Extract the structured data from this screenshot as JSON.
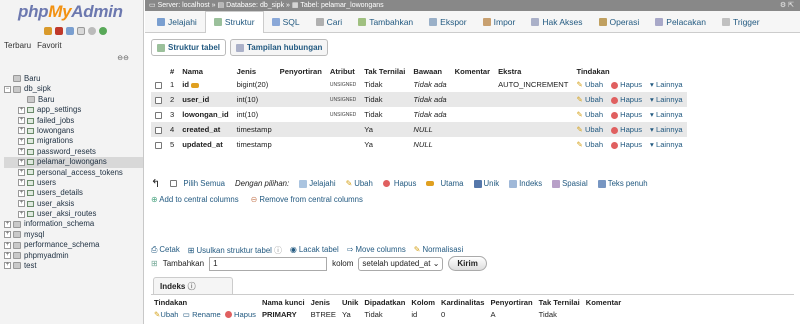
{
  "sidebar": {
    "logo_php": "php",
    "logo_my": "My",
    "logo_admin": "Admin",
    "tab_recent": "Terbaru",
    "tab_favorite": "Favorit",
    "items": [
      {
        "label": "Baru",
        "level": 0
      },
      {
        "label": "db_sipk",
        "level": 0
      },
      {
        "label": "Baru",
        "level": 1
      },
      {
        "label": "app_settings",
        "level": 1
      },
      {
        "label": "failed_jobs",
        "level": 1
      },
      {
        "label": "lowongans",
        "level": 1
      },
      {
        "label": "migrations",
        "level": 1
      },
      {
        "label": "password_resets",
        "level": 1
      },
      {
        "label": "pelamar_lowongans",
        "level": 1
      },
      {
        "label": "personal_access_tokens",
        "level": 1
      },
      {
        "label": "users",
        "level": 1
      },
      {
        "label": "users_details",
        "level": 1
      },
      {
        "label": "user_aksis",
        "level": 1
      },
      {
        "label": "user_aksi_routes",
        "level": 1
      },
      {
        "label": "information_schema",
        "level": 0
      },
      {
        "label": "mysql",
        "level": 0
      },
      {
        "label": "performance_schema",
        "level": 0
      },
      {
        "label": "phpmyadmin",
        "level": 0
      },
      {
        "label": "test",
        "level": 0
      }
    ]
  },
  "breadcrumb": {
    "server": "Server: localhost",
    "database": "Database: db_sipk",
    "table": "Tabel: pelamar_lowongans"
  },
  "tabs": [
    "Jelajahi",
    "Struktur",
    "SQL",
    "Cari",
    "Tambahkan",
    "Ekspor",
    "Impor",
    "Hak Akses",
    "Operasi",
    "Pelacakan",
    "Trigger"
  ],
  "subtabs": {
    "structure": "Struktur tabel",
    "relations": "Tampilan hubungan"
  },
  "structure": {
    "headers": [
      "#",
      "Nama",
      "Jenis",
      "Penyortiran",
      "Atribut",
      "Tak Ternilai",
      "Bawaan",
      "Komentar",
      "Ekstra",
      "Tindakan"
    ],
    "rows": [
      {
        "num": "1",
        "name": "id",
        "type": "bigint(20)",
        "collation": "",
        "attr": "UNSIGNED",
        "null": "Tidak",
        "default": "Tidak ada",
        "comment": "",
        "extra": "AUTO_INCREMENT",
        "key": true
      },
      {
        "num": "2",
        "name": "user_id",
        "type": "int(10)",
        "collation": "",
        "attr": "UNSIGNED",
        "null": "Tidak",
        "default": "Tidak ada",
        "comment": "",
        "extra": "",
        "key": false
      },
      {
        "num": "3",
        "name": "lowongan_id",
        "type": "int(10)",
        "collation": "",
        "attr": "UNSIGNED",
        "null": "Tidak",
        "default": "Tidak ada",
        "comment": "",
        "extra": "",
        "key": false
      },
      {
        "num": "4",
        "name": "created_at",
        "type": "timestamp",
        "collation": "",
        "attr": "",
        "null": "Ya",
        "default": "NULL",
        "comment": "",
        "extra": "",
        "key": false
      },
      {
        "num": "5",
        "name": "updated_at",
        "type": "timestamp",
        "collation": "",
        "attr": "",
        "null": "Ya",
        "default": "NULL",
        "comment": "",
        "extra": "",
        "key": false
      }
    ],
    "actions": {
      "edit": "Ubah",
      "drop": "Hapus",
      "more": "Lainnya"
    }
  },
  "bulk": {
    "check_all": "Pilih Semua",
    "with_selected": "Dengan pilihan:",
    "browse": "Jelajahi",
    "change": "Ubah",
    "drop": "Hapus",
    "primary": "Utama",
    "unique": "Unik",
    "index": "Indeks",
    "spatial": "Spasial",
    "fulltext": "Teks penuh",
    "add_central": "Add to central columns",
    "remove_central": "Remove from central columns"
  },
  "links": {
    "print": "Cetak",
    "propose": "Usulkan struktur tabel",
    "track": "Lacak tabel",
    "move": "Move columns",
    "normalize": "Normalisasi"
  },
  "add": {
    "label": "Tambahkan",
    "count": "1",
    "columns": "kolom",
    "position": "setelah updated_at",
    "submit": "Kirim"
  },
  "indexes": {
    "title": "Indeks",
    "headers": [
      "Tindakan",
      "Nama kunci",
      "Jenis",
      "Unik",
      "Dipadatkan",
      "Kolom",
      "Kardinalitas",
      "Penyortiran",
      "Tak Ternilai",
      "Komentar"
    ],
    "row": {
      "edit": "Ubah",
      "rename": "Rename",
      "drop": "Hapus",
      "keyname": "PRIMARY",
      "type": "BTREE",
      "unique": "Ya",
      "packed": "Tidak",
      "column": "id",
      "cardinality": "0",
      "collation": "A",
      "null": "Tidak",
      "comment": ""
    }
  }
}
